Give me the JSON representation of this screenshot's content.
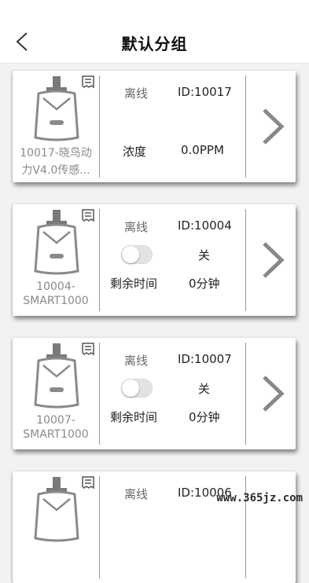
{
  "header": {
    "title": "默认分组",
    "back_icon": "chevron-left-icon"
  },
  "devices": [
    {
      "name_line1": "10017-晓鸟动",
      "name_line2": "力V4.0传感...",
      "status": "离线",
      "id": "ID:10017",
      "row2_label": "浓度",
      "row2_value": "0.0PPM"
    },
    {
      "name_line1": "10004-",
      "name_line2": "SMART1000",
      "status": "离线",
      "id": "ID:10004",
      "toggle_on": false,
      "toggle_text": "关",
      "row2_label": "剩余时间",
      "row2_value": "0分钟"
    },
    {
      "name_line1": "10007-",
      "name_line2": "SMART1000",
      "status": "离线",
      "id": "ID:10007",
      "toggle_on": false,
      "toggle_text": "关",
      "row2_label": "剩余时间",
      "row2_value": "0分钟"
    },
    {
      "status": "离线",
      "id": "ID:10006"
    }
  ],
  "watermark": "www.365jz.com",
  "colors": {
    "accent": "#888888",
    "divider": "#999999",
    "offline_text": "#666666"
  }
}
